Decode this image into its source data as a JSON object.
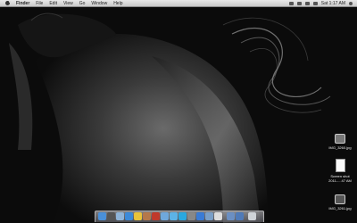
{
  "menubar": {
    "app_name": "Finder",
    "items": [
      "File",
      "Edit",
      "View",
      "Go",
      "Window",
      "Help"
    ],
    "clock": "Sat 1:17 AM",
    "status_icons": [
      "bluetooth-icon",
      "wifi-icon",
      "volume-icon",
      "battery-icon",
      "spotlight-icon"
    ]
  },
  "desktop": {
    "icons": [
      {
        "label_line1": "IMG_3260.jpg",
        "label_line2": "",
        "icon": "image-file-icon"
      },
      {
        "label_line1": "Screen shot",
        "label_line2": "2011-....47 AM",
        "icon": "screenshot-file-icon"
      },
      {
        "label_line1": "IMG_3261.jpg",
        "label_line2": "",
        "icon": "image-file-icon"
      }
    ]
  },
  "dock": {
    "items": [
      {
        "name": "finder",
        "color": "#4a90d9"
      },
      {
        "name": "dashboard",
        "color": "#555555"
      },
      {
        "name": "mail",
        "color": "#8fb4d8"
      },
      {
        "name": "safari",
        "color": "#3c8ad8"
      },
      {
        "name": "chrome",
        "color": "#e8c33a"
      },
      {
        "name": "address-book",
        "color": "#b5784a"
      },
      {
        "name": "photo-booth",
        "color": "#c0392b"
      },
      {
        "name": "itunes",
        "color": "#6fa8dc"
      },
      {
        "name": "twitter",
        "color": "#5cb3e6"
      },
      {
        "name": "skype",
        "color": "#2aa8e0"
      },
      {
        "name": "system-preferences",
        "color": "#888888"
      },
      {
        "name": "app-store",
        "color": "#3a7bd5"
      },
      {
        "name": "preview",
        "color": "#7a9fc7"
      },
      {
        "name": "textedit",
        "color": "#dddddd"
      },
      {
        "name": "documents-stack",
        "color": "#6b8fc2"
      },
      {
        "name": "downloads-stack",
        "color": "#4f7ab8"
      },
      {
        "name": "trash",
        "color": "#cfd3d8"
      }
    ]
  }
}
